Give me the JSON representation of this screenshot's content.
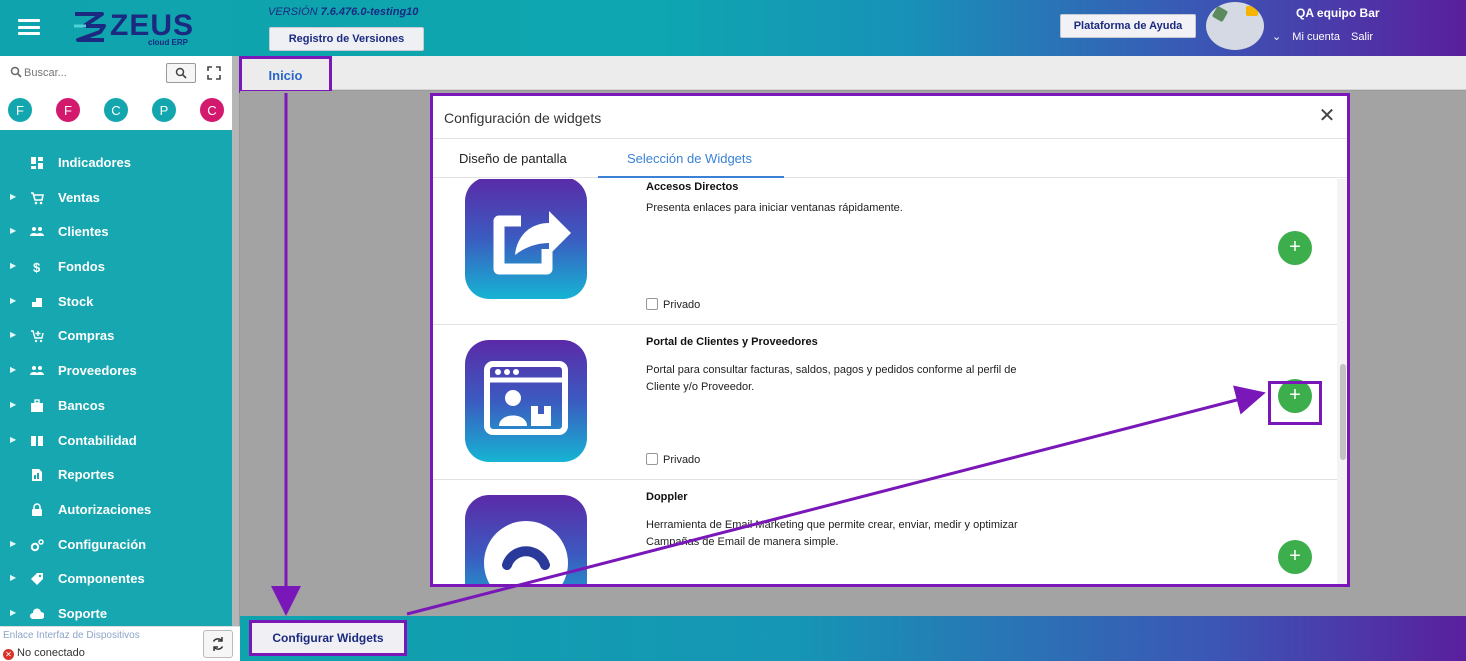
{
  "header": {
    "logo_text": "ZEUS",
    "logo_sub": "cloud ERP",
    "version_prefix": "VERSIÓN",
    "version_number": "7.6.476.0-testing10",
    "versions_button": "Registro de Versiones",
    "help_button": "Plataforma de Ayuda",
    "user_name": "QA equipo Bar",
    "my_account": "Mi cuenta",
    "logout": "Salir"
  },
  "sidebar": {
    "search_placeholder": "Buscar...",
    "quick_access": [
      {
        "letter": "F",
        "color": "#14a6ae"
      },
      {
        "letter": "F",
        "color": "#d3196e"
      },
      {
        "letter": "C",
        "color": "#14a6ae"
      },
      {
        "letter": "P",
        "color": "#14a6ae"
      },
      {
        "letter": "C",
        "color": "#d3196e"
      }
    ],
    "items": [
      {
        "label": "Indicadores",
        "expandable": false,
        "icon": "dashboard-icon"
      },
      {
        "label": "Ventas",
        "expandable": true,
        "icon": "cart-icon"
      },
      {
        "label": "Clientes",
        "expandable": true,
        "icon": "people-icon"
      },
      {
        "label": "Fondos",
        "expandable": true,
        "icon": "dollar-icon"
      },
      {
        "label": "Stock",
        "expandable": true,
        "icon": "box-icon"
      },
      {
        "label": "Compras",
        "expandable": true,
        "icon": "cart-plus-icon"
      },
      {
        "label": "Proveedores",
        "expandable": true,
        "icon": "people-icon"
      },
      {
        "label": "Bancos",
        "expandable": true,
        "icon": "briefcase-icon"
      },
      {
        "label": "Contabilidad",
        "expandable": true,
        "icon": "book-icon"
      },
      {
        "label": "Reportes",
        "expandable": false,
        "icon": "report-icon"
      },
      {
        "label": "Autorizaciones",
        "expandable": false,
        "icon": "lock-icon"
      },
      {
        "label": "Configuración",
        "expandable": true,
        "icon": "gears-icon"
      },
      {
        "label": "Componentes",
        "expandable": true,
        "icon": "tag-icon"
      },
      {
        "label": "Soporte",
        "expandable": true,
        "icon": "cloud-icon"
      }
    ],
    "device_link_label": "Enlace Interfaz de Dispositivos",
    "connection_status": "No conectado"
  },
  "tabs": {
    "home": "Inicio"
  },
  "bottom": {
    "configure_button": "Configurar Widgets"
  },
  "modal": {
    "title": "Configuración de widgets",
    "tab_layout": "Diseño de pantalla",
    "tab_selection": "Selección de Widgets",
    "private_label": "Privado",
    "widgets": [
      {
        "title": "Accesos Directos",
        "description": "Presenta enlaces para iniciar ventanas rápidamente.",
        "icon": "share-icon"
      },
      {
        "title": "Portal de Clientes y Proveedores",
        "description": "Portal para consultar facturas, saldos, pagos y pedidos conforme al perfil de Cliente y/o Proveedor.",
        "icon": "portal-icon"
      },
      {
        "title": "Doppler",
        "description": "Herramienta de Email Marketing que permite crear, enviar, medir y optimizar Campañas de Email de manera simple.",
        "icon": "doppler-icon"
      }
    ]
  },
  "colors": {
    "teal": "#16a7b0",
    "purple_highlight": "#7a17b8",
    "add_green": "#3cae4c",
    "tab_blue": "#3b82d6"
  }
}
